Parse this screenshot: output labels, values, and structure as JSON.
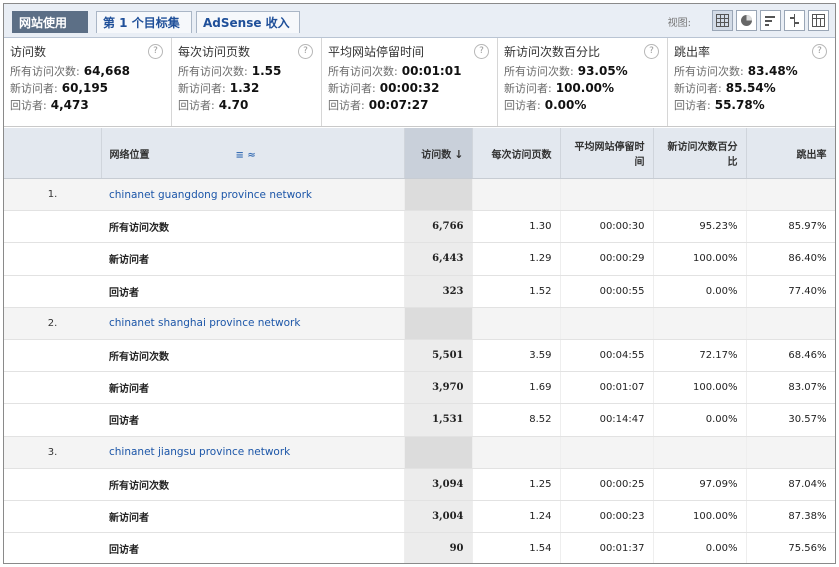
{
  "tabs": [
    {
      "label": "网站使用",
      "active": true
    },
    {
      "label": "第 1 个目标集",
      "active": false
    },
    {
      "label": "AdSense 收入",
      "active": false
    }
  ],
  "view": {
    "label": "视图:",
    "icons": [
      "table-view-icon",
      "pie-view-icon",
      "performance-view-icon",
      "comparison-view-icon",
      "pivot-view-icon"
    ]
  },
  "metrics": [
    {
      "title": "访问数",
      "rows": [
        {
          "label": "所有访问次数:",
          "value": "64,668"
        },
        {
          "label": "新访问者:",
          "value": "60,195"
        },
        {
          "label": "回访者:",
          "value": "4,473"
        }
      ]
    },
    {
      "title": "每次访问页数",
      "rows": [
        {
          "label": "所有访问次数:",
          "value": "1.55"
        },
        {
          "label": "新访问者:",
          "value": "1.32"
        },
        {
          "label": "回访者:",
          "value": "4.70"
        }
      ]
    },
    {
      "title": "平均网站停留时间",
      "rows": [
        {
          "label": "所有访问次数:",
          "value": "00:01:01"
        },
        {
          "label": "新访问者:",
          "value": "00:00:32"
        },
        {
          "label": "回访者:",
          "value": "00:07:27"
        }
      ]
    },
    {
      "title": "新访问次数百分比",
      "rows": [
        {
          "label": "所有访问次数:",
          "value": "93.05%"
        },
        {
          "label": "新访问者:",
          "value": "100.00%"
        },
        {
          "label": "回访者:",
          "value": "0.00%"
        }
      ]
    },
    {
      "title": "跳出率",
      "rows": [
        {
          "label": "所有访问次数:",
          "value": "83.48%"
        },
        {
          "label": "新访问者:",
          "value": "85.54%"
        },
        {
          "label": "回访者:",
          "value": "55.78%"
        }
      ]
    }
  ],
  "table": {
    "headers": {
      "dimension": "网络位置",
      "filter_icon": "≡ ≈",
      "visits": "访问数",
      "pages": "每次访问页数",
      "avg_time": "平均网站停留时间",
      "new_pct": "新访问次数百分比",
      "bounce": "跳出率"
    },
    "groups": [
      {
        "index": "1.",
        "name": "chinanet guangdong province network",
        "rows": [
          {
            "label": "所有访问次数",
            "visits": "6,766",
            "pages": "1.30",
            "time": "00:00:30",
            "new_pct": "95.23%",
            "bounce": "85.97%"
          },
          {
            "label": "新访问者",
            "visits": "6,443",
            "pages": "1.29",
            "time": "00:00:29",
            "new_pct": "100.00%",
            "bounce": "86.40%"
          },
          {
            "label": "回访者",
            "visits": "323",
            "pages": "1.52",
            "time": "00:00:55",
            "new_pct": "0.00%",
            "bounce": "77.40%"
          }
        ]
      },
      {
        "index": "2.",
        "name": "chinanet shanghai province network",
        "rows": [
          {
            "label": "所有访问次数",
            "visits": "5,501",
            "pages": "3.59",
            "time": "00:04:55",
            "new_pct": "72.17%",
            "bounce": "68.46%"
          },
          {
            "label": "新访问者",
            "visits": "3,970",
            "pages": "1.69",
            "time": "00:01:07",
            "new_pct": "100.00%",
            "bounce": "83.07%"
          },
          {
            "label": "回访者",
            "visits": "1,531",
            "pages": "8.52",
            "time": "00:14:47",
            "new_pct": "0.00%",
            "bounce": "30.57%"
          }
        ]
      },
      {
        "index": "3.",
        "name": "chinanet jiangsu province network",
        "rows": [
          {
            "label": "所有访问次数",
            "visits": "3,094",
            "pages": "1.25",
            "time": "00:00:25",
            "new_pct": "97.09%",
            "bounce": "87.04%"
          },
          {
            "label": "新访问者",
            "visits": "3,004",
            "pages": "1.24",
            "time": "00:00:23",
            "new_pct": "100.00%",
            "bounce": "87.38%"
          },
          {
            "label": "回访者",
            "visits": "90",
            "pages": "1.54",
            "time": "00:01:37",
            "new_pct": "0.00%",
            "bounce": "75.56%"
          }
        ]
      }
    ]
  }
}
